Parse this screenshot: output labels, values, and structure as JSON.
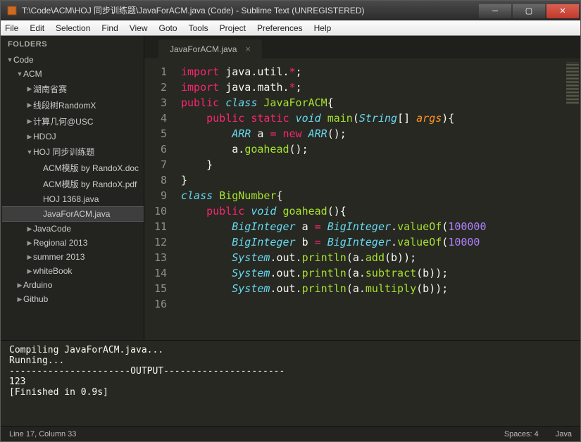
{
  "titlebar": {
    "text": "T:\\Code\\ACM\\HOJ 同步训练题\\JavaForACM.java (Code) - Sublime Text (UNREGISTERED)"
  },
  "menubar": [
    "File",
    "Edit",
    "Selection",
    "Find",
    "View",
    "Goto",
    "Tools",
    "Project",
    "Preferences",
    "Help"
  ],
  "sidebar": {
    "header": "FOLDERS",
    "items": [
      {
        "depth": 0,
        "arrow": "▼",
        "label": "Code"
      },
      {
        "depth": 1,
        "arrow": "▼",
        "label": "ACM"
      },
      {
        "depth": 2,
        "arrow": "▶",
        "label": "湖南省赛"
      },
      {
        "depth": 2,
        "arrow": "▶",
        "label": "线段树RandomX"
      },
      {
        "depth": 2,
        "arrow": "▶",
        "label": "计算几何@USC"
      },
      {
        "depth": 2,
        "arrow": "▶",
        "label": "HDOJ"
      },
      {
        "depth": 2,
        "arrow": "▼",
        "label": "HOJ 同步训练题"
      },
      {
        "depth": 3,
        "arrow": "",
        "label": "ACM模版 by RandoX.doc"
      },
      {
        "depth": 3,
        "arrow": "",
        "label": "ACM模版 by RandoX.pdf"
      },
      {
        "depth": 3,
        "arrow": "",
        "label": "HOJ 1368.java"
      },
      {
        "depth": 3,
        "arrow": "",
        "label": "JavaForACM.java",
        "selected": true
      },
      {
        "depth": 2,
        "arrow": "▶",
        "label": "JavaCode"
      },
      {
        "depth": 2,
        "arrow": "▶",
        "label": "Regional 2013"
      },
      {
        "depth": 2,
        "arrow": "▶",
        "label": "summer 2013"
      },
      {
        "depth": 2,
        "arrow": "▶",
        "label": "whiteBook"
      },
      {
        "depth": 1,
        "arrow": "▶",
        "label": "Arduino"
      },
      {
        "depth": 1,
        "arrow": "▶",
        "label": "Github"
      }
    ]
  },
  "tab": {
    "label": "JavaForACM.java"
  },
  "code_lines": [
    [
      {
        "c": "k-red",
        "t": "import"
      },
      {
        "c": "k-white",
        "t": " java.util."
      },
      {
        "c": "k-red",
        "t": "*"
      },
      {
        "c": "k-white",
        "t": ";"
      }
    ],
    [
      {
        "c": "k-red",
        "t": "import"
      },
      {
        "c": "k-white",
        "t": " java.math."
      },
      {
        "c": "k-red",
        "t": "*"
      },
      {
        "c": "k-white",
        "t": ";"
      }
    ],
    [
      {
        "c": "k-red",
        "t": "public"
      },
      {
        "c": "k-white",
        "t": " "
      },
      {
        "c": "k-blue",
        "t": "class"
      },
      {
        "c": "k-white",
        "t": " "
      },
      {
        "c": "k-green",
        "t": "JavaForACM"
      },
      {
        "c": "k-white",
        "t": "{"
      }
    ],
    [
      {
        "c": "k-white",
        "t": "    "
      },
      {
        "c": "k-red",
        "t": "public static"
      },
      {
        "c": "k-white",
        "t": " "
      },
      {
        "c": "k-blue",
        "t": "void"
      },
      {
        "c": "k-white",
        "t": " "
      },
      {
        "c": "k-green",
        "t": "main"
      },
      {
        "c": "k-white",
        "t": "("
      },
      {
        "c": "k-blue",
        "t": "String"
      },
      {
        "c": "k-white",
        "t": "[] "
      },
      {
        "c": "k-orange",
        "t": "args"
      },
      {
        "c": "k-white",
        "t": "){"
      }
    ],
    [
      {
        "c": "k-white",
        "t": "        "
      },
      {
        "c": "k-blue",
        "t": "ARR"
      },
      {
        "c": "k-white",
        "t": " a "
      },
      {
        "c": "k-red",
        "t": "="
      },
      {
        "c": "k-white",
        "t": " "
      },
      {
        "c": "k-red",
        "t": "new"
      },
      {
        "c": "k-white",
        "t": " "
      },
      {
        "c": "k-blue",
        "t": "ARR"
      },
      {
        "c": "k-white",
        "t": "();"
      }
    ],
    [
      {
        "c": "k-white",
        "t": "        a."
      },
      {
        "c": "k-green",
        "t": "goahead"
      },
      {
        "c": "k-white",
        "t": "();"
      }
    ],
    [
      {
        "c": "k-white",
        "t": "    }"
      }
    ],
    [
      {
        "c": "k-white",
        "t": "}"
      }
    ],
    [
      {
        "c": "k-white",
        "t": ""
      }
    ],
    [
      {
        "c": "k-blue",
        "t": "class"
      },
      {
        "c": "k-white",
        "t": " "
      },
      {
        "c": "k-green",
        "t": "BigNumber"
      },
      {
        "c": "k-white",
        "t": "{"
      }
    ],
    [
      {
        "c": "k-white",
        "t": "    "
      },
      {
        "c": "k-red",
        "t": "public"
      },
      {
        "c": "k-white",
        "t": " "
      },
      {
        "c": "k-blue",
        "t": "void"
      },
      {
        "c": "k-white",
        "t": " "
      },
      {
        "c": "k-green",
        "t": "goahead"
      },
      {
        "c": "k-white",
        "t": "(){"
      }
    ],
    [
      {
        "c": "k-white",
        "t": "        "
      },
      {
        "c": "k-blue",
        "t": "BigInteger"
      },
      {
        "c": "k-white",
        "t": " a "
      },
      {
        "c": "k-red",
        "t": "="
      },
      {
        "c": "k-white",
        "t": " "
      },
      {
        "c": "k-blue",
        "t": "BigInteger"
      },
      {
        "c": "k-white",
        "t": "."
      },
      {
        "c": "k-green",
        "t": "valueOf"
      },
      {
        "c": "k-white",
        "t": "("
      },
      {
        "c": "k-purple",
        "t": "100000"
      }
    ],
    [
      {
        "c": "k-white",
        "t": "        "
      },
      {
        "c": "k-blue",
        "t": "BigInteger"
      },
      {
        "c": "k-white",
        "t": " b "
      },
      {
        "c": "k-red",
        "t": "="
      },
      {
        "c": "k-white",
        "t": " "
      },
      {
        "c": "k-blue",
        "t": "BigInteger"
      },
      {
        "c": "k-white",
        "t": "."
      },
      {
        "c": "k-green",
        "t": "valueOf"
      },
      {
        "c": "k-white",
        "t": "("
      },
      {
        "c": "k-purple",
        "t": "10000"
      }
    ],
    [
      {
        "c": "k-white",
        "t": "        "
      },
      {
        "c": "k-blue",
        "t": "System"
      },
      {
        "c": "k-white",
        "t": ".out."
      },
      {
        "c": "k-green",
        "t": "println"
      },
      {
        "c": "k-white",
        "t": "(a."
      },
      {
        "c": "k-green",
        "t": "add"
      },
      {
        "c": "k-white",
        "t": "(b));"
      }
    ],
    [
      {
        "c": "k-white",
        "t": "        "
      },
      {
        "c": "k-blue",
        "t": "System"
      },
      {
        "c": "k-white",
        "t": ".out."
      },
      {
        "c": "k-green",
        "t": "println"
      },
      {
        "c": "k-white",
        "t": "(a."
      },
      {
        "c": "k-green",
        "t": "subtract"
      },
      {
        "c": "k-white",
        "t": "(b));"
      }
    ],
    [
      {
        "c": "k-white",
        "t": "        "
      },
      {
        "c": "k-blue",
        "t": "System"
      },
      {
        "c": "k-white",
        "t": ".out."
      },
      {
        "c": "k-green",
        "t": "println"
      },
      {
        "c": "k-white",
        "t": "(a."
      },
      {
        "c": "k-green",
        "t": "multiply"
      },
      {
        "c": "k-white",
        "t": "(b));"
      }
    ]
  ],
  "console_lines": [
    "Compiling JavaForACM.java...",
    "Running...",
    "----------------------OUTPUT----------------------",
    "123",
    "[Finished in 0.9s]"
  ],
  "statusbar": {
    "pos": "Line 17, Column 33",
    "spaces": "Spaces: 4",
    "lang": "Java"
  }
}
